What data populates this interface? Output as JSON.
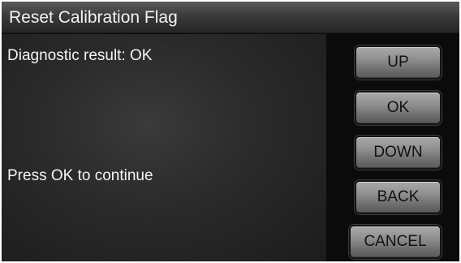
{
  "title": "Reset Calibration Flag",
  "messages": {
    "result": "Diagnostic result: OK",
    "prompt": "Press OK to continue"
  },
  "buttons": {
    "up": "UP",
    "ok": "OK",
    "down": "DOWN",
    "back": "BACK",
    "cancel": "CANCEL"
  }
}
